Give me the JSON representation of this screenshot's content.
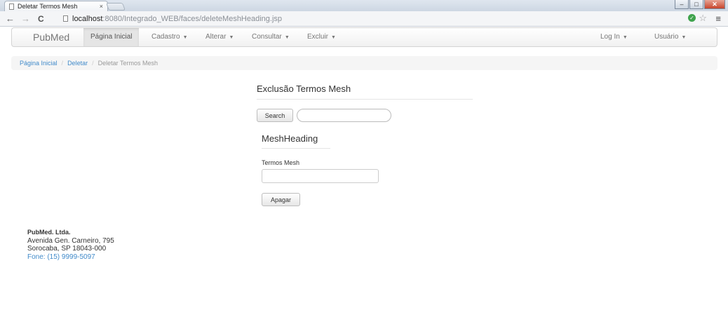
{
  "browser": {
    "tab_title": "Deletar Termos Mesh",
    "tab_close": "×",
    "url_host": "localhost",
    "url_rest": ":8080/Integrado_WEB/faces/deleteMeshHeading.jsp",
    "win_minimize": "–",
    "win_maximize": "□",
    "win_close": "✕",
    "back_icon": "←",
    "forward_icon": "→",
    "reload_icon": "C",
    "star_icon": "☆",
    "menu_icon": "≡",
    "shield_icon": "✓"
  },
  "navbar": {
    "brand": "PubMed",
    "items": [
      {
        "label": "Página Inicial"
      },
      {
        "label": "Cadastro"
      },
      {
        "label": "Alterar"
      },
      {
        "label": "Consultar"
      },
      {
        "label": "Excluir"
      },
      {
        "label": "Log In"
      },
      {
        "label": "Usuário"
      }
    ],
    "caret": "▼"
  },
  "breadcrumb": {
    "items": [
      "Página Inicial",
      "Deletar",
      "Deletar Termos Mesh"
    ],
    "separator": "/"
  },
  "main": {
    "title": "Exclusão Termos Mesh",
    "search_button": "Search",
    "search_value": "",
    "section_title": "MeshHeading",
    "field_label": "Termos Mesh",
    "field_value": "",
    "delete_button": "Apagar"
  },
  "footer": {
    "company": "PubMed. Ltda.",
    "address": "Avenida Gen. Carneiro, 795",
    "city": "Sorocaba, SP 18043-000",
    "phone": "Fone: (15) 9999-5097"
  },
  "colors": {
    "link": "#428bca",
    "navbar_bg": "#f1f1f1",
    "active_bg": "#e5e5e5"
  }
}
